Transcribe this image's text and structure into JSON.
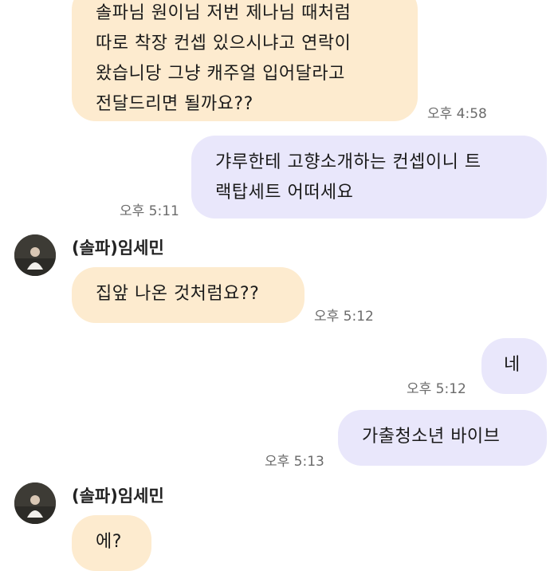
{
  "messages": [
    {
      "lines": [
        "솔파님 원이님 저번 제나님 때처럼",
        "따로 착장 컨셉 있으시냐고 연락이",
        "왔습니당 그냥 캐주얼 입어달라고",
        "전달드리면 될까요??"
      ],
      "time": "오후 4:58"
    },
    {
      "lines": [
        "갸루한테 고향소개하는 컨셉이니 트",
        "랙탑세트 어떠세요"
      ],
      "time": "오후 5:11"
    },
    {
      "sender": "(솔파)임세민",
      "lines": [
        "집앞 나온 것처럼요??"
      ],
      "time": "오후 5:12"
    },
    {
      "lines": [
        "네"
      ],
      "time": "오후 5:12"
    },
    {
      "lines": [
        "가출청소년 바이브"
      ],
      "time": "오후 5:13"
    },
    {
      "sender": "(솔파)임세민",
      "lines": [
        "에?"
      ]
    }
  ],
  "colors": {
    "incoming_bubble": "#fdebcf",
    "outgoing_bubble": "#e9e7fb",
    "timestamp": "#6b6b6b"
  }
}
